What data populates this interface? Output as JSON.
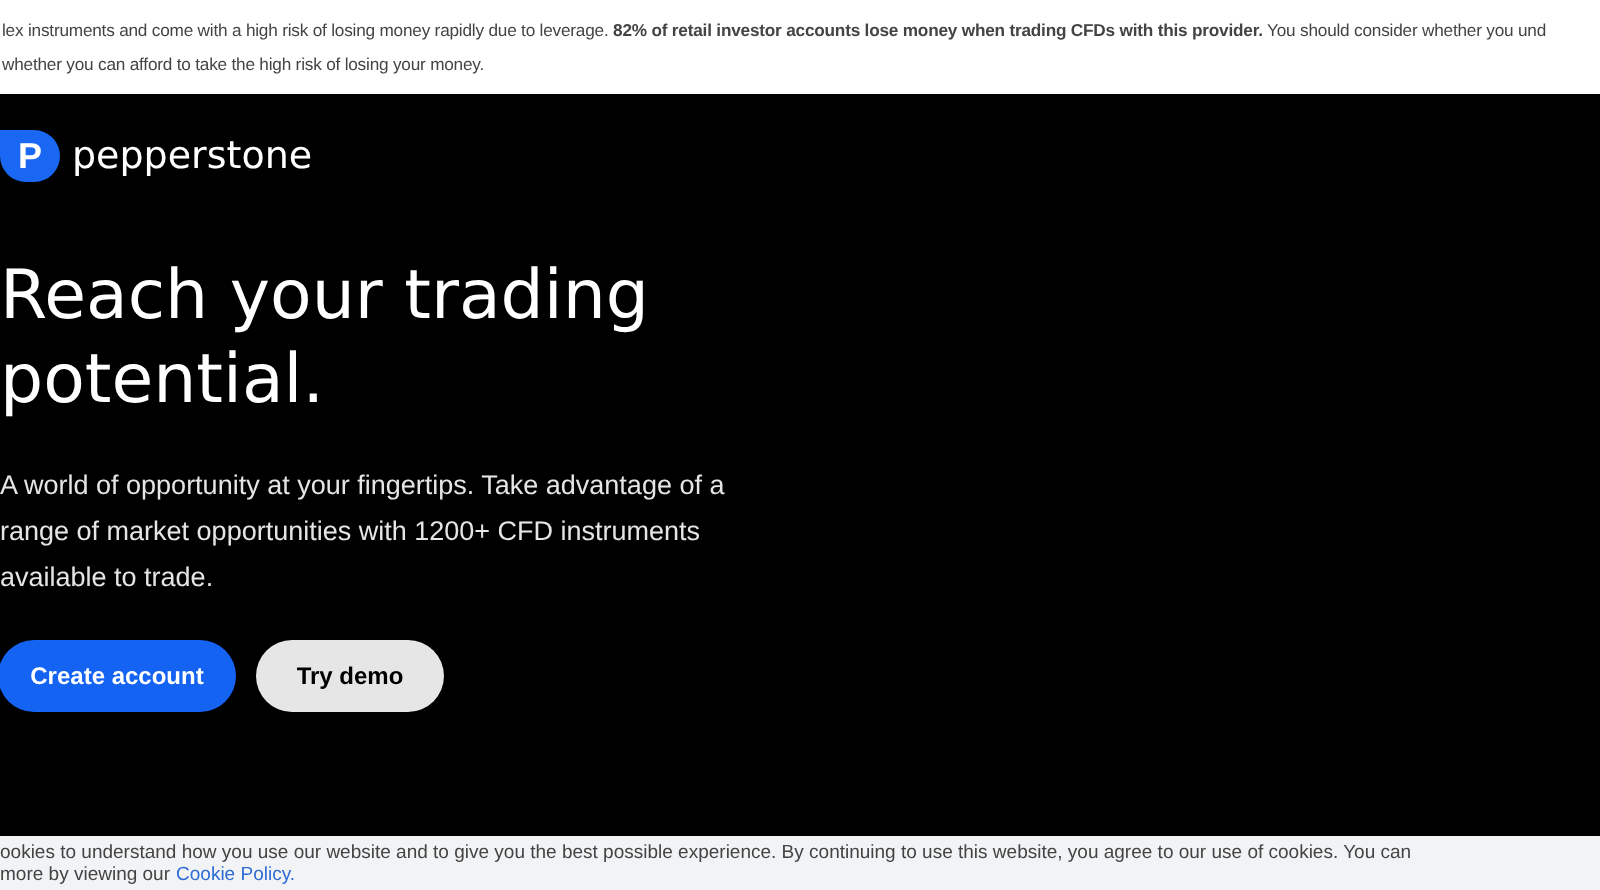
{
  "risk_warning": {
    "line_1": "lex instruments and come with a high risk of losing money rapidly due to leverage. **82% of retail investor accounts lose money when trading CFDs with this provider.** You should consider whether you und",
    "line_2": "whether you can afford to take the high risk of losing your money."
  },
  "brand": {
    "logo_letter": "P",
    "name": "pepperstone"
  },
  "hero": {
    "heading_line_1": "Reach your trading",
    "heading_line_2": "potential.",
    "body_line_1": "A world of opportunity at your fingertips. Take advantage of a",
    "body_line_2": "range of market opportunities with 1200+ CFD instruments",
    "body_line_3": "available to trade."
  },
  "buttons": [
    {
      "label": "Create account",
      "kind": "primary"
    },
    {
      "label": "Try demo",
      "kind": "secondary"
    }
  ],
  "cookie_banner": {
    "line_1": "ookies to understand how you use our website and to give you the best possible experience. By continuing to use this website, you agree to our use of cookies. You can",
    "line_2": "more by viewing our",
    "link": "Cookie Policy."
  }
}
